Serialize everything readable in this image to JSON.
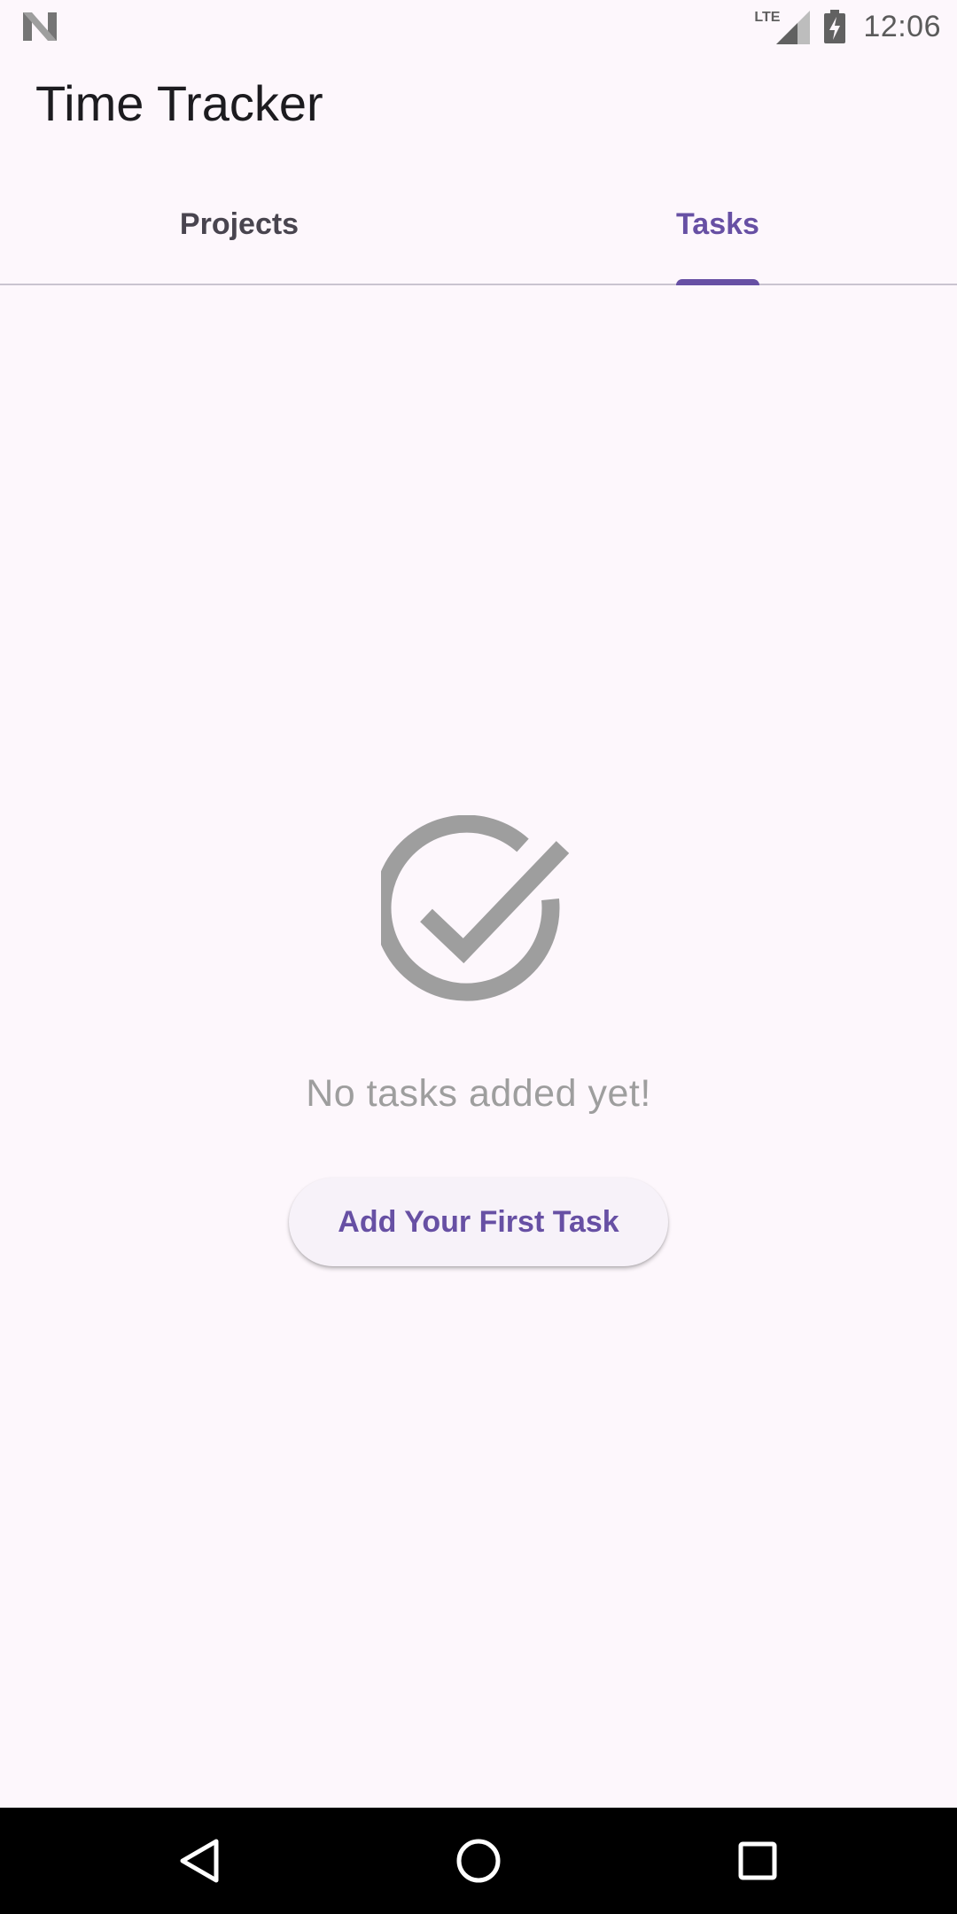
{
  "status_bar": {
    "network_label": "LTE",
    "time": "12:06",
    "icons": [
      "n-logo-icon",
      "signal-icon",
      "battery-charging-icon"
    ]
  },
  "app_bar": {
    "title": "Time Tracker"
  },
  "tabs": [
    {
      "label": "Projects",
      "selected": false
    },
    {
      "label": "Tasks",
      "selected": true
    }
  ],
  "empty_state": {
    "icon": "check-circle-icon",
    "message": "No tasks added yet!",
    "button_label": "Add Your First Task"
  },
  "navigation": {
    "icons": [
      "back-icon",
      "home-icon",
      "recents-icon"
    ]
  },
  "colors": {
    "accent": "#6750A4",
    "background": "#FDF7FC",
    "muted": "#9E9E9E"
  }
}
